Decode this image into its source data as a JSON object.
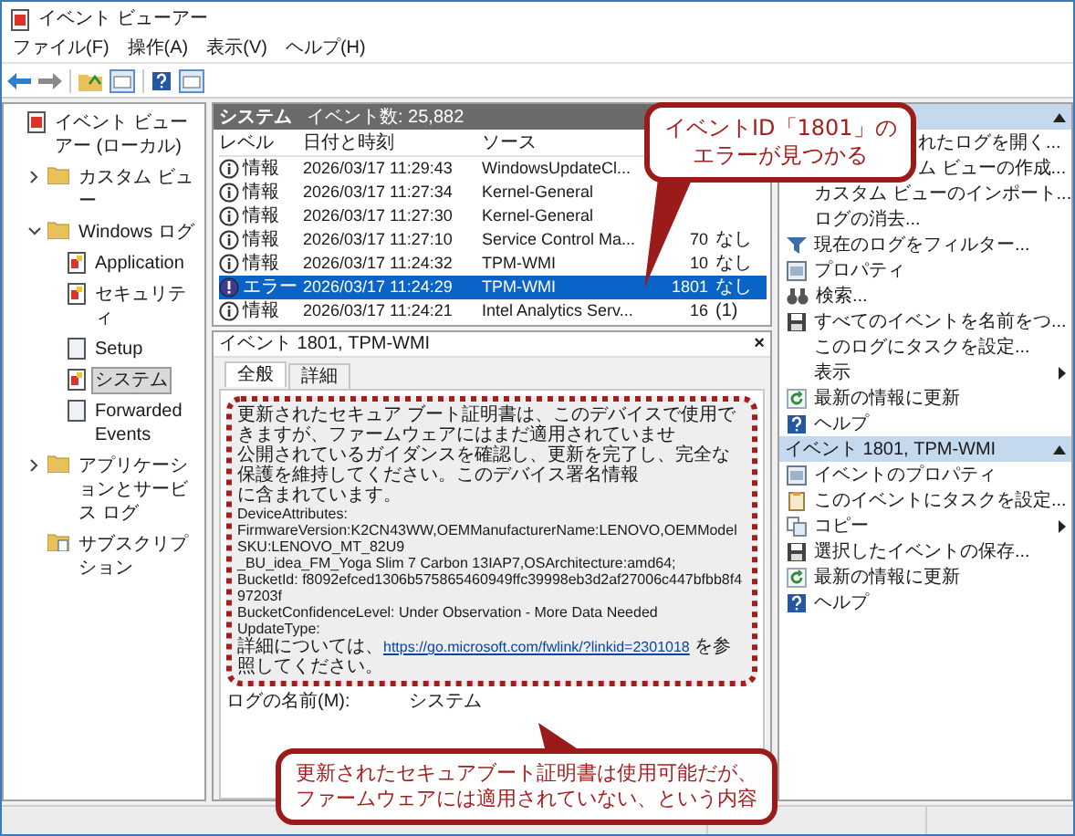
{
  "window": {
    "title": "イベント ビューアー"
  },
  "menu": [
    "ファイル(F)",
    "操作(A)",
    "表示(V)",
    "ヘルプ(H)"
  ],
  "tree": [
    {
      "label": "イベント ビューアー (ローカル)",
      "kind": "root",
      "selected": false,
      "children": [
        {
          "label": "カスタム ビュー",
          "kind": "folder",
          "expanded": false,
          "selected": false
        },
        {
          "label": "Windows ログ",
          "kind": "folder",
          "expanded": true,
          "selected": false,
          "children": [
            {
              "label": "Application",
              "kind": "log",
              "selected": false
            },
            {
              "label": "セキュリティ",
              "kind": "log",
              "selected": false
            },
            {
              "label": "Setup",
              "kind": "plain",
              "selected": false
            },
            {
              "label": "システム",
              "kind": "log",
              "selected": true
            },
            {
              "label": "Forwarded Events",
              "kind": "plain",
              "selected": false
            }
          ]
        },
        {
          "label": "アプリケーションとサービス ログ",
          "kind": "folder",
          "expanded": false,
          "selected": false
        },
        {
          "label": "サブスクリプション",
          "kind": "sub",
          "selected": false
        }
      ]
    }
  ],
  "log_header": {
    "name": "システム",
    "count": "イベント数: 25,882"
  },
  "table": {
    "columns": [
      "レベル",
      "日付と時刻",
      "ソース"
    ],
    "rows": [
      {
        "kind": "info",
        "level": "情報",
        "date": "2026/03/17 11:29:43",
        "source": "WindowsUpdateCl...",
        "selected": false
      },
      {
        "kind": "info",
        "level": "情報",
        "date": "2026/03/17 11:27:34",
        "source": "Kernel-General",
        "selected": false
      },
      {
        "kind": "info",
        "level": "情報",
        "date": "2026/03/17 11:27:30",
        "source": "Kernel-General",
        "selected": false
      },
      {
        "kind": "info",
        "level": "情報",
        "date": "2026/03/17 11:27:10",
        "source": "Service Control Ma...",
        "event_id": "70",
        "task": "なし",
        "selected": false
      },
      {
        "kind": "info",
        "level": "情報",
        "date": "2026/03/17 11:24:32",
        "source": "TPM-WMI",
        "event_id": "10",
        "task": "なし",
        "selected": false
      },
      {
        "kind": "error",
        "level": "エラー",
        "date": "2026/03/17 11:24:29",
        "source": "TPM-WMI",
        "event_id": "1801",
        "task": "なし",
        "selected": true
      },
      {
        "kind": "info",
        "level": "情報",
        "date": "2026/03/17 11:24:21",
        "source": "Intel Analytics Serv...",
        "event_id": "16",
        "task": "(1)",
        "selected": false
      }
    ]
  },
  "event_pane": {
    "title": "イベント 1801, TPM-WMI",
    "close": "×",
    "tabs": [
      {
        "label": "全般",
        "selected": true
      },
      {
        "label": "詳細",
        "selected": false
      }
    ],
    "description": [
      "更新されたセキュア ブート証明書は、このデバイスで使用できますが、ファームウェアにはまだ適用されていませ",
      "公開されているガイダンスを確認し、更新を完了し、完全な保護を維持してください。このデバイス署名情報",
      "に含まれています。"
    ],
    "lines": [
      "DeviceAttributes:",
      "FirmwareVersion:K2CN43WW,OEMManufacturerName:LENOVO,OEMModelSKU:LENOVO_MT_82U9",
      "_BU_idea_FM_Yoga Slim 7 Carbon 13IAP7,OSArchitecture:amd64;",
      "BucketId: f8092efced1306b575865460949ffc39998eb3d2af27006c447bfbb8f497203f",
      "BucketConfidenceLevel: Under Observation - More Data Needed",
      "UpdateType:"
    ],
    "link_line": {
      "before": "詳細については、",
      "url": "https://go.microsoft.com/fwlink/?linkid=2301018",
      "after": " を参照してください。"
    },
    "fields": [
      {
        "label": "ログの名前(M):",
        "value": "システム"
      }
    ]
  },
  "actions": [
    {
      "items": [
        {
          "label": "れたログを開く...",
          "kind": "covered"
        },
        {
          "label": "ム ビューの作成...",
          "kind": "covered"
        },
        {
          "label": "カスタム ビューのインポート...",
          "kind": "plain"
        },
        {
          "label": "ログの消去...",
          "kind": "plain"
        },
        {
          "label": "現在のログをフィルター...",
          "kind": "filter"
        },
        {
          "label": "プロパティ",
          "kind": "props"
        },
        {
          "label": "検索...",
          "kind": "find"
        },
        {
          "label": "すべてのイベントを名前をつ...",
          "kind": "save"
        },
        {
          "label": "このログにタスクを設定...",
          "kind": "plain"
        },
        {
          "label": "表示",
          "kind": "plain",
          "submenu": true
        },
        {
          "label": "最新の情報に更新",
          "kind": "refresh"
        },
        {
          "label": "ヘルプ",
          "kind": "help"
        }
      ]
    },
    {
      "title": "イベント 1801, TPM-WMI",
      "items": [
        {
          "label": "イベントのプロパティ",
          "kind": "props"
        },
        {
          "label": "このイベントにタスクを設定...",
          "kind": "task"
        },
        {
          "label": "コピー",
          "kind": "copy",
          "submenu": true
        },
        {
          "label": "選択したイベントの保存...",
          "kind": "save"
        },
        {
          "label": "最新の情報に更新",
          "kind": "refresh"
        },
        {
          "label": "ヘルプ",
          "kind": "help"
        }
      ]
    }
  ],
  "callouts": [
    {
      "lines": [
        "イベントID「1801」の",
        "エラーが見つかる"
      ]
    },
    {
      "lines": [
        "更新されたセキュアブート証明書は使用可能だが、",
        "ファームウェアには適用されていない、という内容"
      ]
    }
  ]
}
